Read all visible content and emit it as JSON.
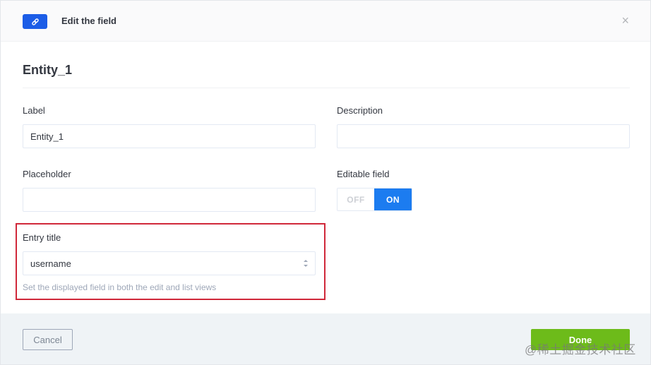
{
  "header": {
    "title": "Edit the field",
    "icon": "link-icon",
    "close_icon": "close-icon",
    "close_symbol": "×"
  },
  "section": {
    "title": "Entity_1"
  },
  "form": {
    "label": {
      "label": "Label",
      "value": "Entity_1"
    },
    "description": {
      "label": "Description",
      "value": ""
    },
    "placeholder": {
      "label": "Placeholder",
      "value": ""
    },
    "editable": {
      "label": "Editable field",
      "off_label": "OFF",
      "on_label": "ON",
      "state": "on"
    },
    "entry_title": {
      "label": "Entry title",
      "selected": "username",
      "helper": "Set the displayed field in both the edit and list views"
    }
  },
  "footer": {
    "cancel_label": "Cancel",
    "done_label": "Done"
  },
  "watermark": "@稀土掘金技术社区",
  "colors": {
    "primary": "#1c7cf0",
    "header_icon_bg": "#1c5de7",
    "done_green": "#6dbb1a",
    "highlight_red": "#d0283a"
  }
}
